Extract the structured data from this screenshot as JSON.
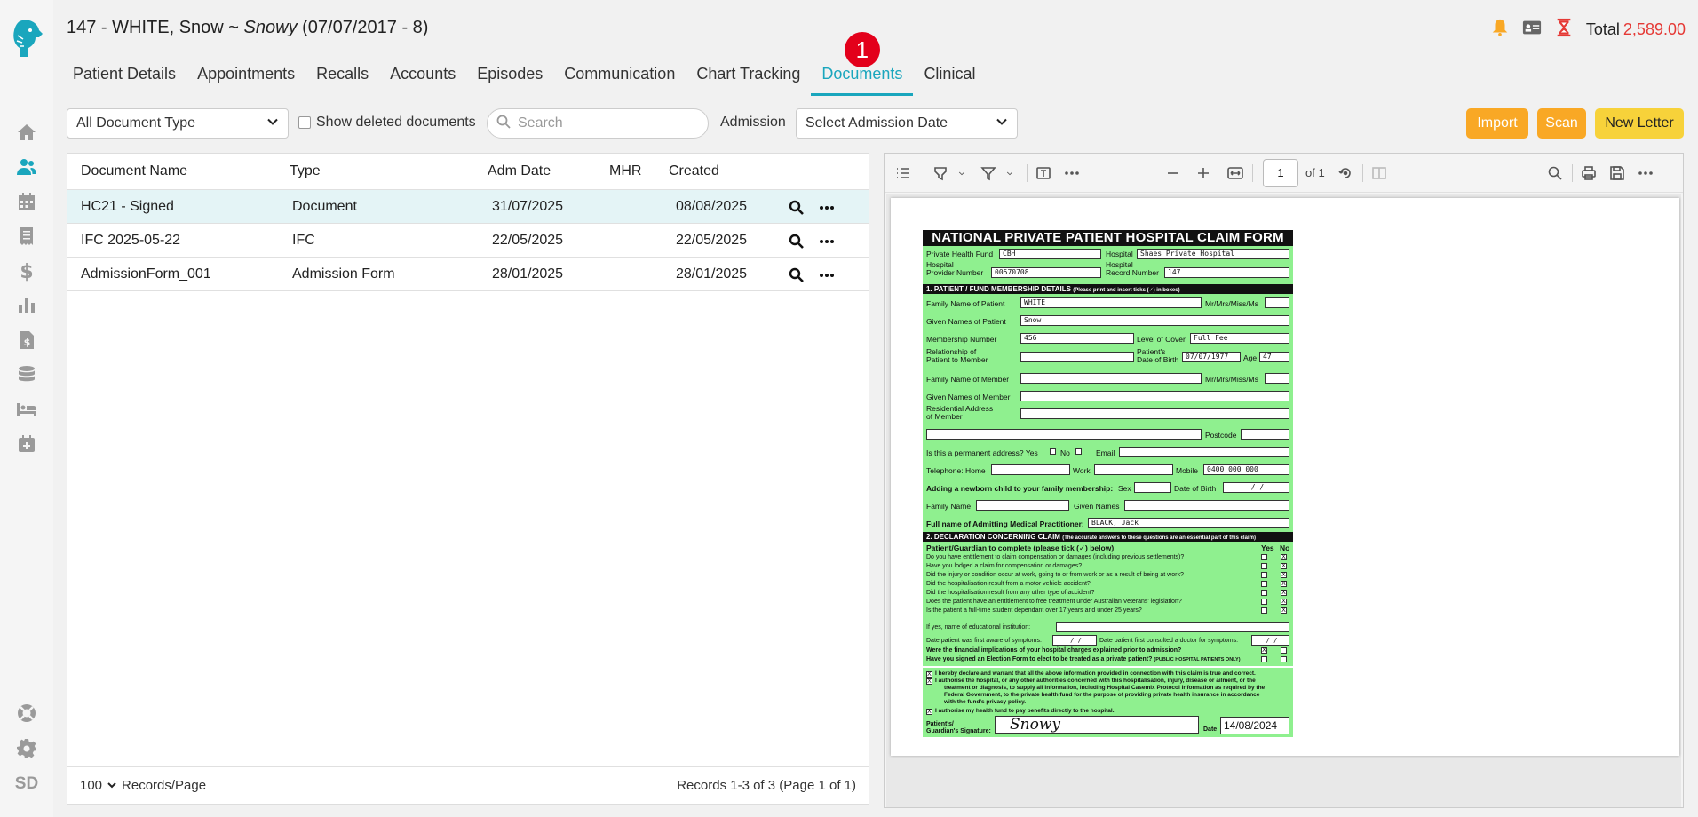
{
  "header": {
    "patient_id": "147",
    "patient_name": "WHITE, Snow",
    "separator": "~",
    "nickname": "Snowy",
    "dob_age": "(07/07/2017 - 8)",
    "total_label": "Total",
    "total_value": "2,589.00"
  },
  "sidebar": {
    "user_initials": "SD"
  },
  "tabs": [
    {
      "label": "Patient Details"
    },
    {
      "label": "Appointments"
    },
    {
      "label": "Recalls"
    },
    {
      "label": "Accounts"
    },
    {
      "label": "Episodes"
    },
    {
      "label": "Communication"
    },
    {
      "label": "Chart Tracking"
    },
    {
      "label": "Documents",
      "badge": "1"
    },
    {
      "label": "Clinical"
    }
  ],
  "toolbar": {
    "doc_type_value": "All Document Type",
    "show_deleted_label": "Show deleted documents",
    "search_placeholder": "Search",
    "admission_label": "Admission",
    "admission_value": "Select Admission Date",
    "import_label": "Import",
    "scan_label": "Scan",
    "new_letter_label": "New Letter"
  },
  "table": {
    "columns": [
      "Document Name",
      "Type",
      "Adm Date",
      "MHR",
      "Created"
    ],
    "rows": [
      {
        "name": "HC21 - Signed",
        "type": "Document",
        "adm_date": "31/07/2025",
        "mhr": "",
        "created": "08/08/2025"
      },
      {
        "name": "IFC 2025-05-22",
        "type": "IFC",
        "adm_date": "22/05/2025",
        "mhr": "",
        "created": "22/05/2025"
      },
      {
        "name": "AdmissionForm_001",
        "type": "Admission Form",
        "adm_date": "28/01/2025",
        "mhr": "",
        "created": "28/01/2025"
      }
    ],
    "page_size": "100",
    "page_size_label": "Records/Page",
    "records_text": "Records 1-3 of 3 (Page 1 of 1)"
  },
  "viewer": {
    "page_current": "1",
    "page_of": "of 1"
  },
  "form": {
    "title": "NATIONAL PRIVATE PATIENT HOSPITAL CLAIM FORM",
    "phf_label": "Private Health Fund",
    "phf_value": "CBH",
    "hospital_label": "Hospital",
    "hospital_value": "Shaes Private Hospital",
    "prov_label_1": "Hospital",
    "prov_label_2": "Provider Number",
    "prov_value": "00570708",
    "rec_label_1": "Hospital",
    "rec_label_2": "Record Number",
    "rec_value": "147",
    "sec1_title": "1. PATIENT / FUND MEMBERSHIP DETAILS",
    "sec1_note": "(Please print and insert ticks (✓) in boxes)",
    "family_label": "Family Name of Patient",
    "family_value": "WHITE",
    "title_label": "Mr/Mrs/Miss/Ms",
    "given_label": "Given Names of Patient",
    "given_value": "Snow",
    "membership_label": "Membership Number",
    "membership_value": "456",
    "cover_label": "Level of Cover",
    "cover_value": "Full Fee",
    "rel_label_1": "Relationship of",
    "rel_label_2": "Patient to Member",
    "pdob_label_1": "Patient's",
    "pdob_label_2": "Date of Birth",
    "pdob_value": "07/07/1977",
    "age_label": "Age",
    "age_value": "47",
    "mfamily_label": "Family Name of Member",
    "mgiven_label": "Given Names of Member",
    "raddr_label_1": "Residential Address",
    "raddr_label_2": "of Member",
    "postcode_label": "Postcode",
    "perm_label": "Is this a permanent address? Yes",
    "no_label": "No",
    "email_label": "Email",
    "tel_label": "Telephone: Home",
    "work_label": "Work",
    "mobile_label": "Mobile",
    "mobile_value": "0400 000 000",
    "newborn_label": "Adding a newborn child to your family membership:",
    "sex_label": "Sex",
    "dob_label": "Date of Birth",
    "dob_blank": "/     /",
    "fname_label": "Family Name",
    "gnames_label": "Given Names",
    "practitioner_label": "Full name of Admitting Medical Practitioner:",
    "practitioner_value": "BLACK, Jack",
    "sec2_title": "2. DECLARATION CONCERNING CLAIM",
    "sec2_note": "(The accurate answers to these questions are an essential part of this claim)",
    "guardian_label": "Patient/Guardian to complete (please tick (✓) below)",
    "yes_label": "Yes",
    "no_col_label": "No",
    "questions": [
      "Do you have entitlement to claim compensation or damages (including previous settlements)?",
      "Have you lodged a claim for compensation or damages?",
      "Did the injury or condition occur at work, going to or from work or as a result of being at work?",
      "Did the hospitalisation result from a motor vehicle accident?",
      "Did the hospitalisation result from any other type of accident?",
      "Does the patient have an entitlement to free treatment under Australian Veterans' legislation?",
      "Is the patient a full-time student dependant over 17 years and under 25 years?"
    ],
    "edu_label": "If yes, name of educational institution:",
    "aware_label": "Date patient was first aware of symptoms:",
    "consult_label": "Date patient first consulted a doctor for symptoms:",
    "date_blank": "/     /",
    "fin_label": "Were the financial implications of your hospital charges explained prior to admission?",
    "election_label": "Have you signed an Election Form to elect to be treated as a private patient?",
    "election_note": "(PUBLIC HOSPITAL PATIENTS ONLY)",
    "decl_1": "I hereby declare and warrant that all the above information provided in connection with this claim is true and correct.",
    "decl_2a": "I authorise the hospital, or any other authorities concerned with this hospitalisation, injury, disease or ailment, or the",
    "decl_2b": "treatment or diagnosis, to supply all information, including Hospital Casemix Protocol information as required by the",
    "decl_2c": "Federal Government, to the private health fund for the purpose of providing private health insurance in accordance",
    "decl_2d": "with the fund's privacy policy.",
    "decl_3": "I authorise my health fund to pay benefits directly to the hospital.",
    "sig_label_1": "Patient's/",
    "sig_label_2": "Guardian's Signature:",
    "sig_value": "Snowy",
    "date_label": "Date",
    "date_value": "14/08/2024",
    "tick": "X"
  },
  "colors": {
    "accent": "#1aa6bd",
    "badge": "#e3001b",
    "total": "#e53935",
    "orange_button": "#f9a825",
    "yellow_button": "#f7d23a",
    "form_bg": "#8ff08f"
  }
}
